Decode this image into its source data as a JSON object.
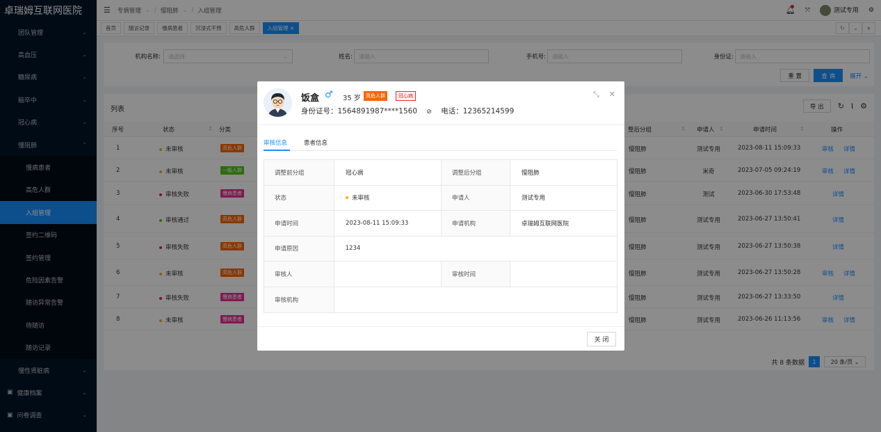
{
  "brand": "卓瑞姆互联网医院",
  "sidebar": {
    "items": [
      {
        "label": "团队管理",
        "chev": "⌄",
        "sub": false
      },
      {
        "label": "高血压",
        "chev": "⌄",
        "sub": false
      },
      {
        "label": "糖尿病",
        "chev": "⌄",
        "sub": false
      },
      {
        "label": "脑卒中",
        "chev": "⌄",
        "sub": false
      },
      {
        "label": "冠心病",
        "chev": "⌄",
        "sub": false
      },
      {
        "label": "慢阻肺",
        "chev": "⌃",
        "sub": false
      },
      {
        "label": "慢病患者",
        "sub": true
      },
      {
        "label": "高危人群",
        "sub": true
      },
      {
        "label": "入组管理",
        "sub": true,
        "active": true
      },
      {
        "label": "签约二维码",
        "sub": true
      },
      {
        "label": "签约管理",
        "sub": true
      },
      {
        "label": "危险因素告警",
        "sub": true
      },
      {
        "label": "随访异常告警",
        "sub": true
      },
      {
        "label": "待随访",
        "sub": true
      },
      {
        "label": "随访记录",
        "sub": true
      },
      {
        "label": "慢性肾脏病",
        "chev": "⌄",
        "sub": false
      },
      {
        "label": "健康档案",
        "chev": "⌄",
        "sub": false,
        "icon": true
      },
      {
        "label": "问卷调查",
        "chev": "⌄",
        "sub": false,
        "icon": true
      }
    ]
  },
  "breadcrumb": {
    "a": "专病管理",
    "b": "慢阻肺",
    "c": "入组管理"
  },
  "user": {
    "name": "测试专用"
  },
  "tabs": [
    "首页",
    "随访记录",
    "慢病患者",
    "沉浸式干预",
    "高危人群",
    "入组管理 ×"
  ],
  "filters": {
    "org_label": "机构名称:",
    "org_placeholder": "请选择",
    "name_label": "姓名:",
    "name_placeholder": "请输入",
    "phone_label": "手机号:",
    "phone_placeholder": "请输入",
    "idcard_label": "身份证:",
    "idcard_placeholder": "请输入",
    "reset": "重 置",
    "search": "查 询",
    "expand": "展开 ⌄"
  },
  "list": {
    "title": "列表",
    "export": "导 出",
    "headers": {
      "no": "序号",
      "status": "状态",
      "type": "分类",
      "after_group": "整后分组",
      "applicant": "申请人",
      "apply_time": "申请时间",
      "op": "操作"
    },
    "rows": [
      {
        "no": "1",
        "status": "未审核",
        "status_color": "#faad14",
        "type": "高危人群",
        "type_color": "#fa6400",
        "group": "慢阻肺",
        "applicant": "测试专用",
        "time": "2023-08-11 15:09:33",
        "audit": "审核",
        "detail": "详情"
      },
      {
        "no": "2",
        "status": "未审核",
        "status_color": "#faad14",
        "type": "一般人群",
        "type_color": "#52c41a",
        "group": "慢阻肺",
        "applicant": "米奇",
        "time": "2023-07-05 09:24:19",
        "audit": "审核",
        "detail": "详情"
      },
      {
        "no": "3",
        "status": "审核失败",
        "status_color": "#f5222d",
        "type": "慢病患者",
        "type_color": "#eb2f96",
        "group": "慢阻肺",
        "applicant": "测试",
        "time": "2023-06-30 17:53:48",
        "audit": "",
        "detail": "详情"
      },
      {
        "no": "4",
        "status": "审核通过",
        "status_color": "#52c41a",
        "type": "高危人群",
        "type_color": "#fa6400",
        "group": "慢阻肺",
        "applicant": "测试专用",
        "time": "2023-06-27 13:50:41",
        "audit": "",
        "detail": "详情"
      },
      {
        "no": "5",
        "status": "审核失败",
        "status_color": "#f5222d",
        "type": "高危人群",
        "type_color": "#fa6400",
        "group": "慢阻肺",
        "applicant": "测试专用",
        "time": "2023-06-27 13:50:38",
        "audit": "",
        "detail": "详情"
      },
      {
        "no": "6",
        "status": "未审核",
        "status_color": "#faad14",
        "type": "高危人群",
        "type_color": "#fa6400",
        "group": "慢阻肺",
        "applicant": "测试专用",
        "time": "2023-06-27 13:50:28",
        "audit": "审核",
        "detail": "详情"
      },
      {
        "no": "7",
        "status": "审核失败",
        "status_color": "#f5222d",
        "type": "慢病患者",
        "type_color": "#eb2f96",
        "group": "慢阻肺",
        "applicant": "测试专用",
        "time": "2023-06-27 13:33:50",
        "audit": "",
        "detail": "详情"
      },
      {
        "no": "8",
        "status": "未审核",
        "status_color": "#faad14",
        "type": "慢病患者",
        "type_color": "#eb2f96",
        "group": "慢阻肺",
        "applicant": "测试专用",
        "time": "2023-06-26 11:13:56",
        "audit": "审核",
        "detail": "详情"
      }
    ],
    "total": "共 8 条数据",
    "page": "1",
    "page_size": "20 条/页 ⌄"
  },
  "modal": {
    "name": "饭盒",
    "gender": "♂",
    "age": "35 岁",
    "tag1": "高危人群",
    "tag2": "冠心病",
    "idcard": "身份证号：1564891987****1560",
    "phone": "电话：12365214599",
    "tab_audit": "审核信息",
    "tab_patient": "患者信息",
    "fields": {
      "before_label": "调整前分组",
      "before": "冠心病",
      "after_label": "调整后分组",
      "after": "慢阻肺",
      "status_label": "状态",
      "status": "未审核",
      "applicant_label": "申请人",
      "applicant": "测试专用",
      "time_label": "申请时间",
      "time": "2023-08-11 15:09:33",
      "org_label": "申请机构",
      "org": "卓瑞姆互联网医院",
      "reason_label": "申请原因",
      "reason": "1234",
      "auditor_label": "审核人",
      "auditor": "",
      "audit_time_label": "审核时间",
      "audit_time": "",
      "audit_org_label": "审核机构",
      "audit_org": ""
    },
    "close": "关 闭"
  }
}
